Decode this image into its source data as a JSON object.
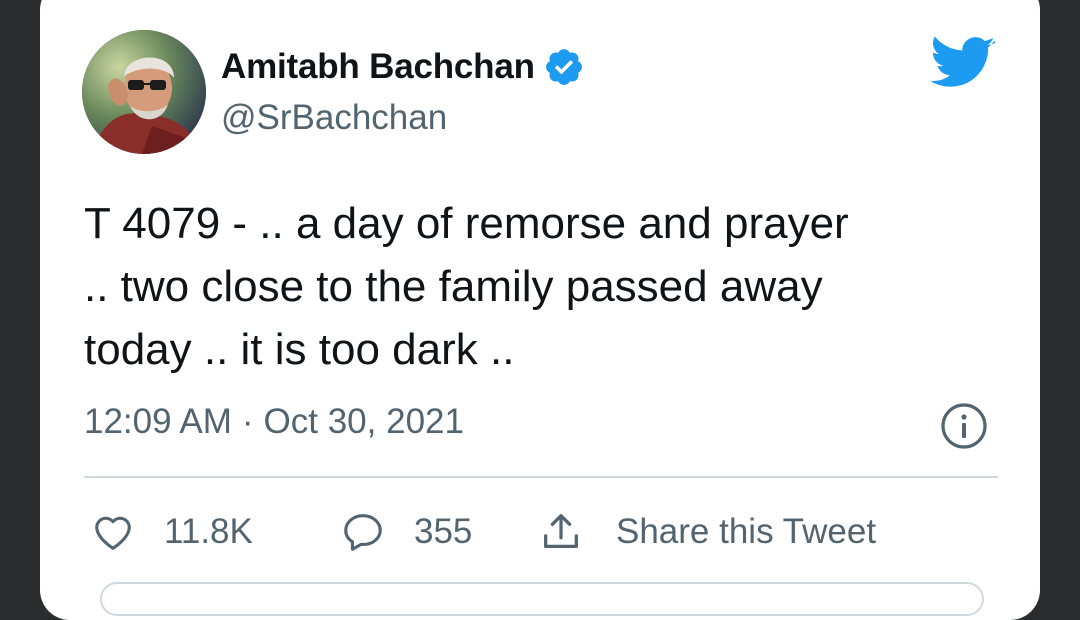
{
  "tweet": {
    "author_name": "Amitabh Bachchan",
    "handle": "@SrBachchan",
    "text_lines": [
      "T 4079 - .. a day of remorse and prayer",
      ".. two close to the family passed away",
      "today .. it is too dark .."
    ],
    "time": "12:09 AM",
    "separator": "·",
    "date": "Oct 30, 2021"
  },
  "actions": {
    "likes": "11.8K",
    "replies": "355",
    "share_label": "Share this Tweet"
  },
  "icons": {
    "verified": "verified-badge-icon",
    "brand": "twitter-bird-icon",
    "info": "info-icon",
    "like": "heart-icon",
    "reply": "reply-bubble-icon",
    "share": "share-icon"
  },
  "colors": {
    "brand_blue": "#1d9bf0",
    "text_primary": "#0f1419",
    "text_secondary": "#536471",
    "divider": "#cfd9de",
    "background": "#2a2c2e"
  }
}
